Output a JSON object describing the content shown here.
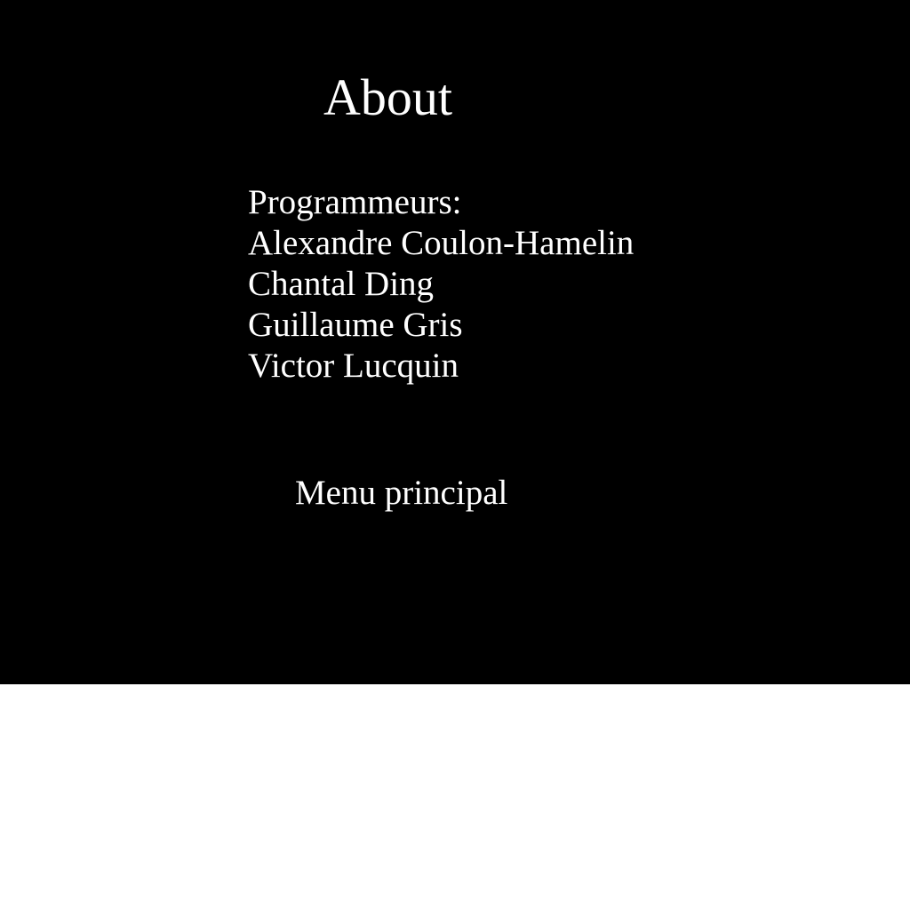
{
  "screen": {
    "title": "About",
    "credits_heading": "Programmeurs:",
    "programmers": [
      "Alexandre Coulon-Hamelin",
      "Chantal Ding",
      "Guillaume Gris",
      "Victor Lucquin"
    ],
    "main_menu_label": "Menu principal"
  },
  "colors": {
    "background": "#000000",
    "text": "#ffffff",
    "outside_area": "#ffffff"
  }
}
